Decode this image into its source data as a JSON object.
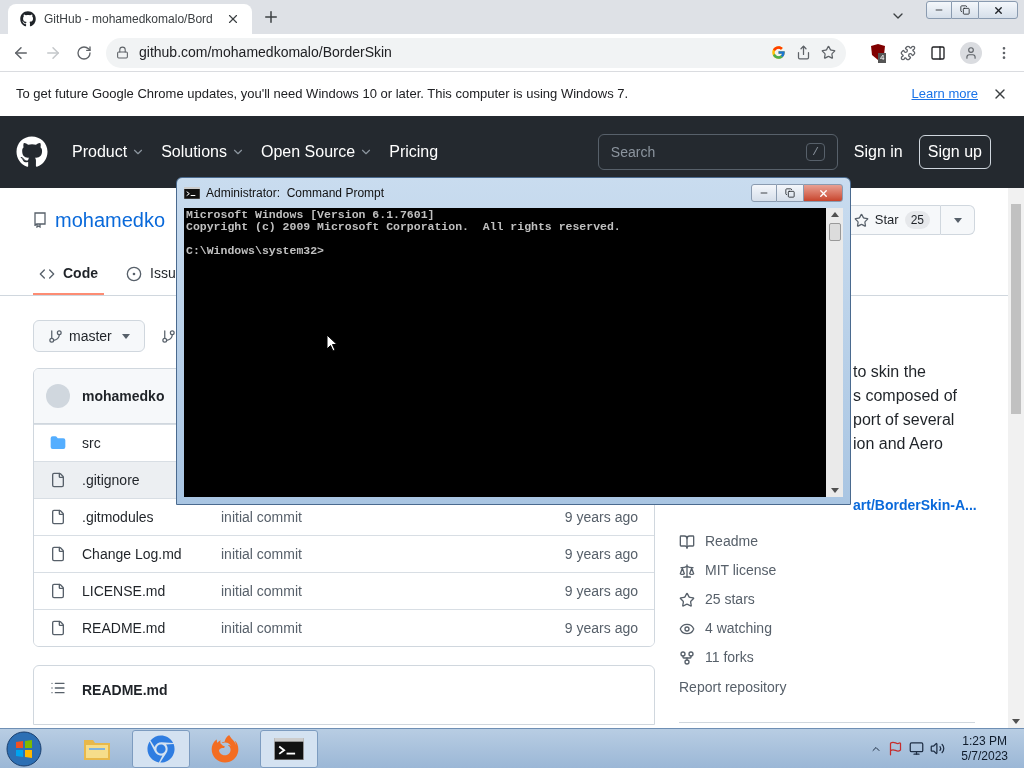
{
  "browser": {
    "tabs": [
      {
        "title": "GitHub - mohamedkomalo/Bord",
        "selected": true
      }
    ],
    "address": "github.com/mohamedkomalo/BorderSkin",
    "forward_disabled": true,
    "extension_badge": "4"
  },
  "infobar": {
    "message": "To get future Google Chrome updates, you'll need Windows 10 or later. This computer is using Windows 7.",
    "link": "Learn more"
  },
  "github_header": {
    "nav": [
      {
        "label": "Product",
        "dropdown": true
      },
      {
        "label": "Solutions",
        "dropdown": true
      },
      {
        "label": "Open Source",
        "dropdown": true
      },
      {
        "label": "Pricing",
        "dropdown": false
      }
    ],
    "search_placeholder": "Search",
    "search_key": "/",
    "sign_in": "Sign in",
    "sign_up": "Sign up"
  },
  "repo": {
    "owner": "mohamedko",
    "star_label": "Star",
    "star_count": "25",
    "tabs": [
      {
        "kind": "code",
        "label": "Code",
        "selected": true
      },
      {
        "kind": "issues",
        "label": "Issu",
        "selected": false
      }
    ],
    "branch": "master",
    "commit_author": "mohamedko",
    "files": [
      {
        "kind": "folder",
        "name": "src",
        "hovered": false
      },
      {
        "kind": "file",
        "name": ".gitignore",
        "hovered": true
      },
      {
        "kind": "file",
        "name": ".gitmodules",
        "message": "initial commit",
        "age": "9 years ago",
        "hovered": false
      },
      {
        "kind": "file",
        "name": "Change Log.md",
        "message": "initial commit",
        "age": "9 years ago",
        "hovered": false
      },
      {
        "kind": "file",
        "name": "LICENSE.md",
        "message": "initial commit",
        "age": "9 years ago",
        "hovered": false
      },
      {
        "kind": "file",
        "name": "README.md",
        "message": "initial commit",
        "age": "9 years ago",
        "hovered": false
      }
    ],
    "readme_title": "README.md"
  },
  "about": {
    "description_lines": [
      "to skin the",
      "s composed of",
      "port of several",
      "ion and Aero"
    ],
    "link": "art/BorderSkin-A...",
    "items": [
      {
        "kind": "book",
        "label": "Readme"
      },
      {
        "kind": "scale",
        "label": "MIT license"
      },
      {
        "kind": "star",
        "label": "25 stars"
      },
      {
        "kind": "eye",
        "label": "4 watching"
      },
      {
        "kind": "fork",
        "label": "11 forks"
      }
    ],
    "report": "Report repository"
  },
  "console": {
    "title": "Administrator:  Command Prompt",
    "blocks": [
      [
        "Microsoft Windows [Version 6.1.7601]",
        "Copyright (c) 2009 Microsoft Corporation.  All rights reserved."
      ],
      [
        "C:\\Windows\\system32>"
      ]
    ]
  },
  "taskbar": {
    "apps": [
      {
        "kind": "explorer",
        "active": false
      },
      {
        "kind": "chrome",
        "active": true
      },
      {
        "kind": "firefox",
        "active": false
      },
      {
        "kind": "console",
        "active": true
      }
    ],
    "time": "1:23 PM",
    "date": "5/7/2023"
  }
}
